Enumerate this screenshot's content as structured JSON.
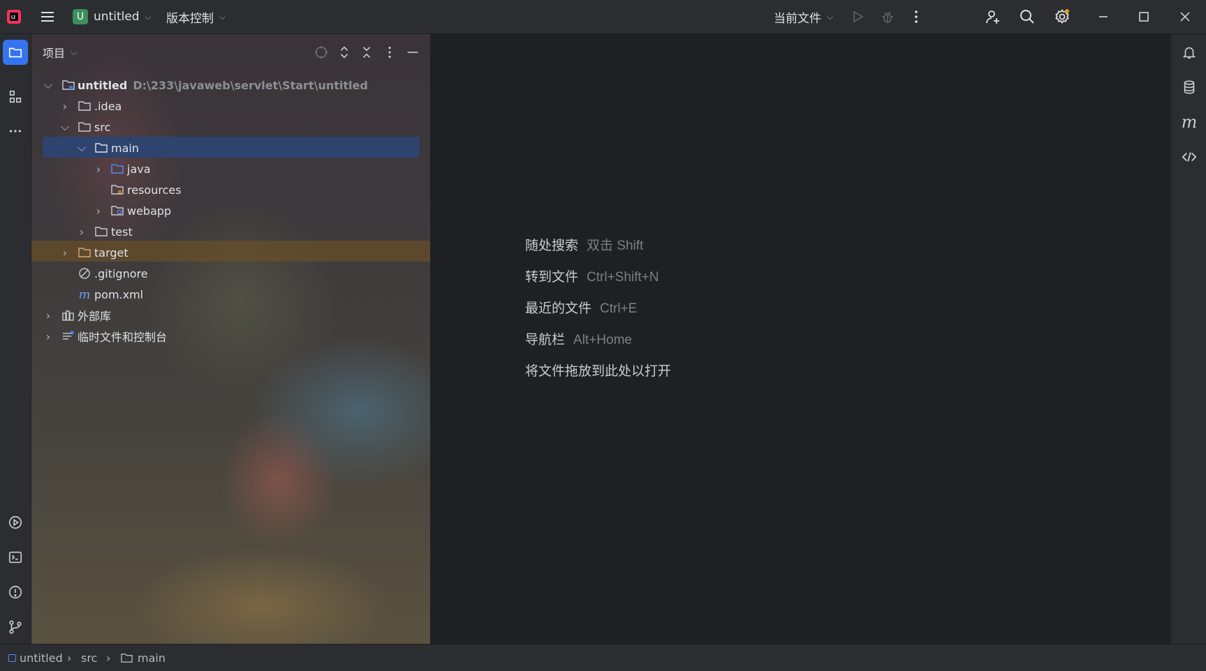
{
  "titlebar": {
    "project_badge": "U",
    "project_name": "untitled",
    "vcs_label": "版本控制",
    "run_config": "当前文件"
  },
  "project_panel": {
    "title": "项目",
    "tree": [
      {
        "label": "untitled",
        "path": "D:\\233\\javaweb\\servlet\\Start\\untitled"
      },
      {
        "label": ".idea"
      },
      {
        "label": "src"
      },
      {
        "label": "main"
      },
      {
        "label": "java"
      },
      {
        "label": "resources"
      },
      {
        "label": "webapp"
      },
      {
        "label": "test"
      },
      {
        "label": "target"
      },
      {
        "label": ".gitignore"
      },
      {
        "label": "pom.xml"
      },
      {
        "label": "外部库"
      },
      {
        "label": "临时文件和控制台"
      }
    ]
  },
  "editor": {
    "hints": [
      {
        "action": "随处搜索",
        "key": "双击 Shift"
      },
      {
        "action": "转到文件",
        "key": "Ctrl+Shift+N"
      },
      {
        "action": "最近的文件",
        "key": "Ctrl+E"
      },
      {
        "action": "导航栏",
        "key": "Alt+Home"
      },
      {
        "action": "将文件拖放到此处以打开",
        "key": ""
      }
    ]
  },
  "statusbar": {
    "breadcrumbs": [
      "untitled",
      "src",
      "main"
    ]
  },
  "colors": {
    "selection": "#2e436e",
    "accent": "#3574f0",
    "target_highlight": "#4d3f26",
    "notification_dot": "#e5a50a"
  }
}
